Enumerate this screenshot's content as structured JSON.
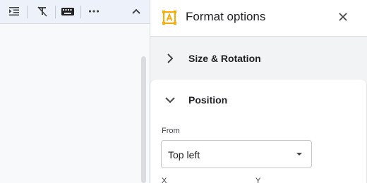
{
  "toolbar": {
    "icons": [
      "indent-icon",
      "clear-formatting-icon",
      "keyboard-icon",
      "more-icon",
      "collapse-toolbar-icon"
    ]
  },
  "panel": {
    "title": "Format options",
    "sections": [
      {
        "label": "Size & Rotation",
        "expanded": false
      },
      {
        "label": "Position",
        "expanded": true
      }
    ],
    "position": {
      "from_label": "From",
      "from_value": "Top left",
      "x_label": "X",
      "y_label": "Y"
    }
  },
  "colors": {
    "accent": "#f9ab00",
    "toolbar_bg": "#edf2fa",
    "panel_bg": "#f1f3f4"
  }
}
